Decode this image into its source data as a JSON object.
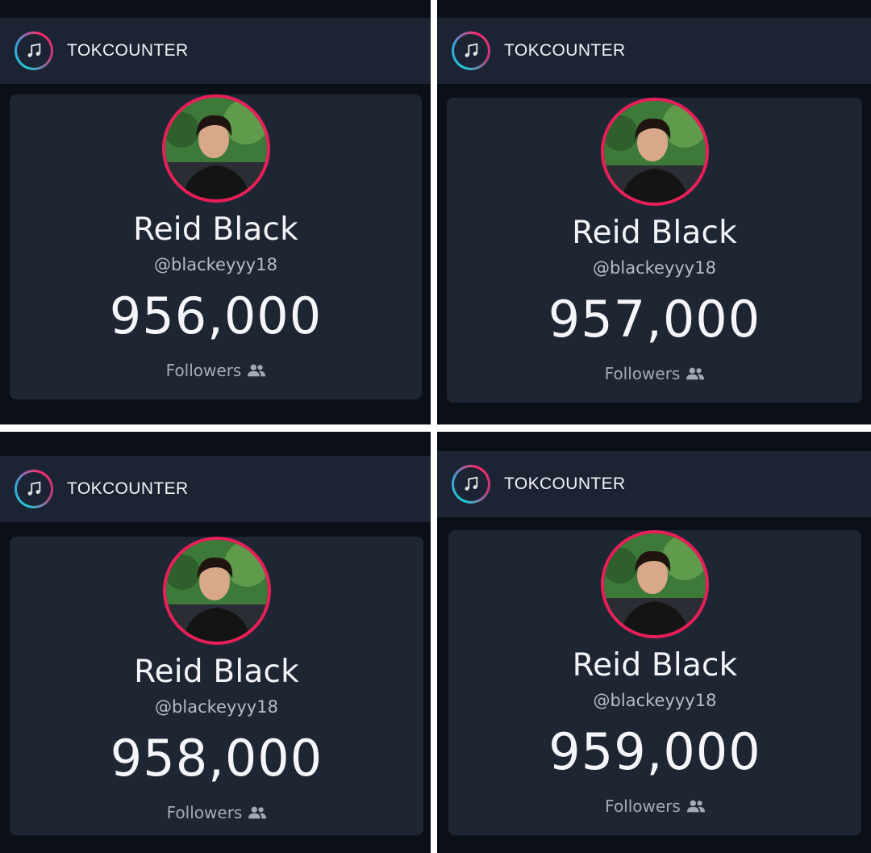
{
  "panels": [
    {
      "brand": "TOKCOUNTER",
      "name": "Reid Black",
      "handle": "@blackeyyy18",
      "count": "956,000",
      "followers_label": "Followers"
    },
    {
      "brand": "TOKCOUNTER",
      "name": "Reid Black",
      "handle": "@blackeyyy18",
      "count": "957,000",
      "followers_label": "Followers"
    },
    {
      "brand": "TOKCOUNTER",
      "name": "Reid Black",
      "handle": "@blackeyyy18",
      "count": "958,000",
      "followers_label": "Followers"
    },
    {
      "brand": "TOKCOUNTER",
      "name": "Reid Black",
      "handle": "@blackeyyy18",
      "count": "959,000",
      "followers_label": "Followers"
    }
  ],
  "icons": {
    "logo": "music-note-icon",
    "followers": "users-icon"
  },
  "colors": {
    "header_bg": "#1c2433",
    "card_bg": "#1e2533",
    "avatar_ring": "#ea1f59",
    "logo_cyan": "#22c9d6",
    "logo_pink": "#ff2a6d"
  }
}
